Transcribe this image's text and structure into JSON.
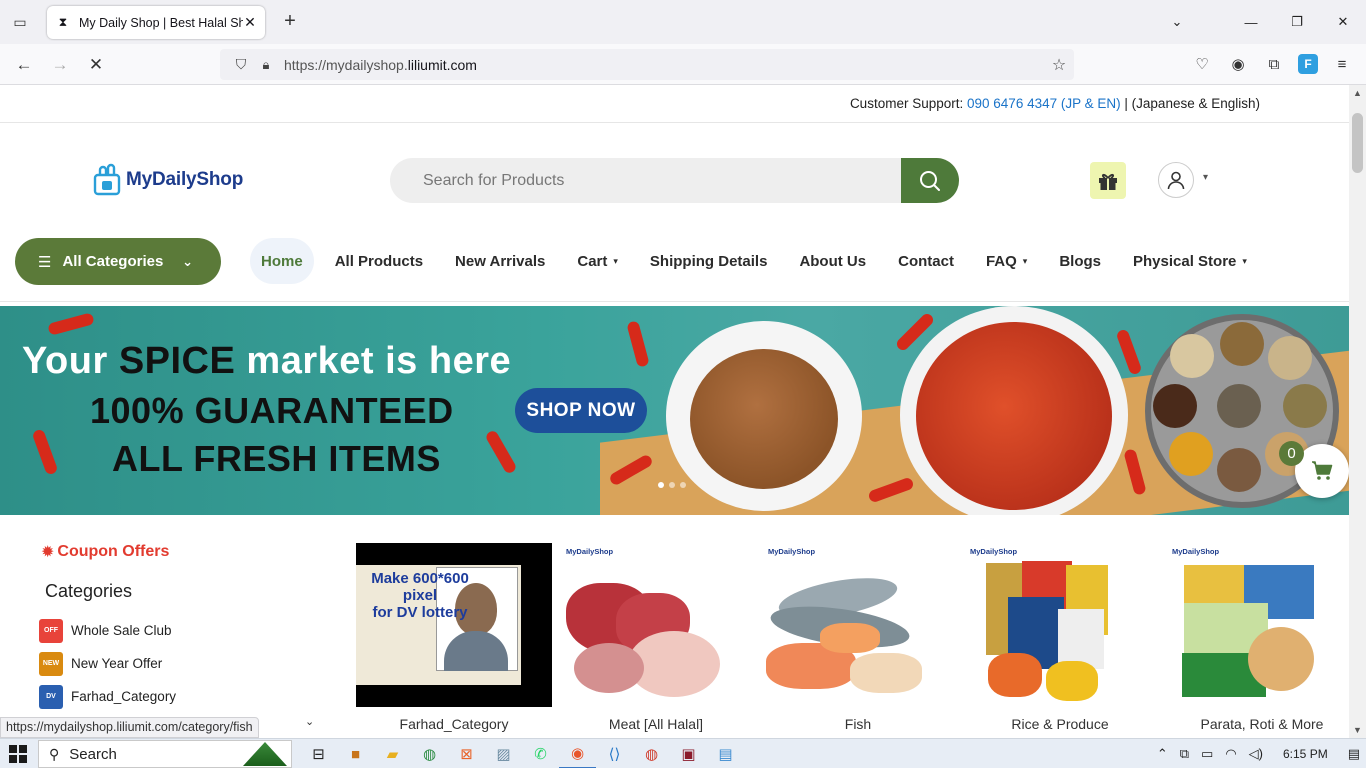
{
  "browser": {
    "tab_title": "My Daily Shop | Best Halal Shop",
    "url_prefix": "https://mydailyshop.",
    "url_domain": "liliumit.com",
    "status_url": "https://mydailyshop.liliumit.com/category/fish"
  },
  "support": {
    "label": "Customer Support:",
    "phone": "090 6476 4347 (JP & EN)",
    "separator": "|",
    "languages": "(Japanese & English)"
  },
  "logo": {
    "text": "MyDailyShop"
  },
  "search": {
    "placeholder": "Search for Products"
  },
  "nav": {
    "all_categories": "All Categories",
    "items": [
      {
        "label": "Home",
        "active": true,
        "dropdown": false
      },
      {
        "label": "All Products",
        "dropdown": false
      },
      {
        "label": "New Arrivals",
        "dropdown": false
      },
      {
        "label": "Cart",
        "dropdown": true
      },
      {
        "label": "Shipping Details",
        "dropdown": false
      },
      {
        "label": "About Us",
        "dropdown": false
      },
      {
        "label": "Contact",
        "dropdown": false
      },
      {
        "label": "FAQ",
        "dropdown": true
      },
      {
        "label": "Blogs",
        "dropdown": false
      },
      {
        "label": "Physical Store",
        "dropdown": true
      }
    ]
  },
  "banner": {
    "line1_a": "Your",
    "line1_hl": "SPICE",
    "line1_b": "market is here",
    "line2": "100% GUARANTEED",
    "line3": "ALL FRESH ITEMS",
    "cta": "SHOP NOW",
    "slide_count": 3,
    "active_slide": 1
  },
  "cart": {
    "count": "0"
  },
  "sidebar": {
    "coupon": "Coupon Offers",
    "categories_title": "Categories",
    "categories": [
      {
        "label": "Whole Sale Club",
        "color": "#e8433a",
        "thumb": "OFF"
      },
      {
        "label": "New Year Offer",
        "color": "#d98a10",
        "thumb": "NEW"
      },
      {
        "label": "Farhad_Category",
        "color": "#2a5fb0",
        "thumb": "DV"
      }
    ]
  },
  "products": [
    {
      "name": "Farhad_Category",
      "img_text_1": "Make 600*600",
      "img_text_2": "pixel",
      "img_text_3": "for DV lottery"
    },
    {
      "name": "Meat [All Halal]",
      "brand": "MyDailyShop"
    },
    {
      "name": "Fish",
      "brand": "MyDailyShop"
    },
    {
      "name": "Rice & Produce",
      "brand": "MyDailyShop"
    },
    {
      "name": "Parata, Roti & More",
      "brand": "MyDailyShop"
    }
  ],
  "taskbar": {
    "search": "Search",
    "time": "6:15 PM"
  },
  "colors": {
    "brand_green": "#5b7a39",
    "search_btn": "#4e7a3a",
    "brand_blue": "#1d3c8c",
    "coupon_red": "#e23b2f",
    "phone_blue": "#1a73c8"
  }
}
